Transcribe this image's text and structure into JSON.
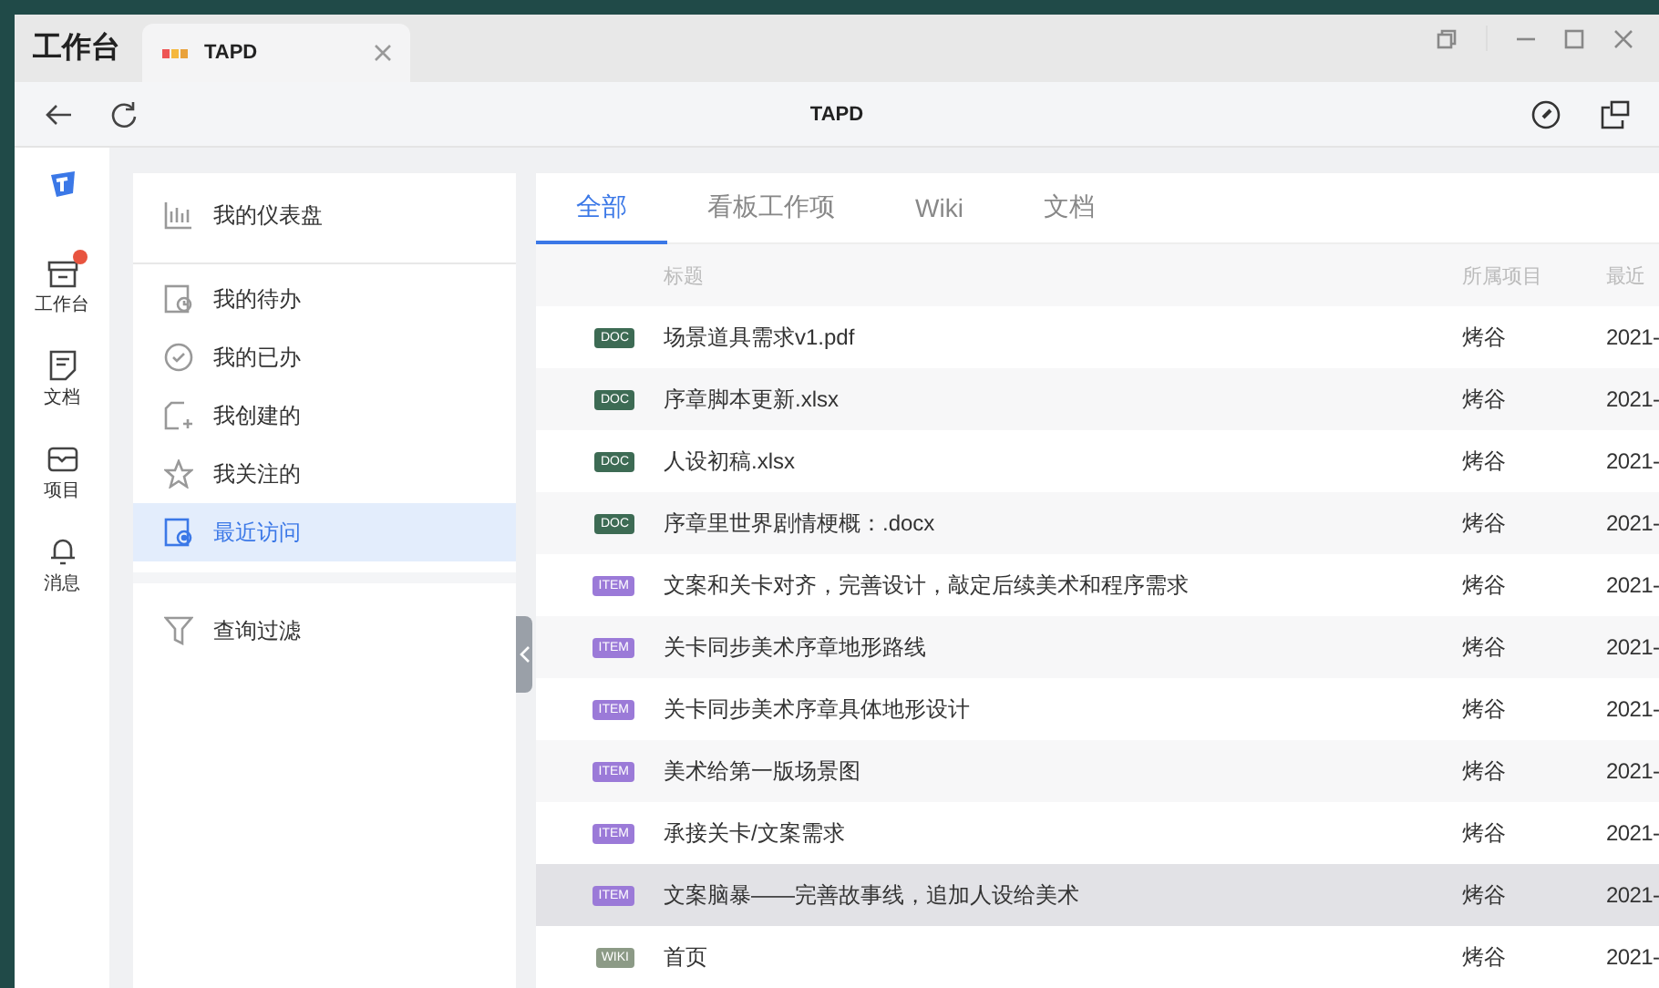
{
  "window": {
    "app_title": "工作台",
    "tab": {
      "title": "TAPD"
    },
    "page_title": "TAPD"
  },
  "rail": [
    {
      "label": "工作台",
      "kind": "workbench",
      "badge": true
    },
    {
      "label": "文档",
      "kind": "doc",
      "badge": false
    },
    {
      "label": "项目",
      "kind": "project",
      "badge": false
    },
    {
      "label": "消息",
      "kind": "bell",
      "badge": false
    }
  ],
  "menu": [
    {
      "label": "我的仪表盘",
      "kind": "chart",
      "selected": false
    },
    {
      "label": "我的待办",
      "kind": "todo",
      "selected": false
    },
    {
      "label": "我的已办",
      "kind": "done",
      "selected": false
    },
    {
      "label": "我创建的",
      "kind": "created",
      "selected": false
    },
    {
      "label": "我关注的",
      "kind": "star",
      "selected": false
    },
    {
      "label": "最近访问",
      "kind": "recent",
      "selected": true
    },
    {
      "label": "查询过滤",
      "kind": "filter",
      "selected": false
    }
  ],
  "tabs": [
    {
      "label": "全部",
      "selected": true
    },
    {
      "label": "看板工作项",
      "selected": false
    },
    {
      "label": "Wiki",
      "selected": false
    },
    {
      "label": "文档",
      "selected": false
    }
  ],
  "table": {
    "columns": [
      "标题",
      "所属项目",
      "最近"
    ],
    "rows": [
      {
        "type": "DOC",
        "title": "场景道具需求v1.pdf",
        "project": "烤谷",
        "date": "2021-",
        "hovered": false
      },
      {
        "type": "DOC",
        "title": "序章脚本更新.xlsx",
        "project": "烤谷",
        "date": "2021-",
        "hovered": false
      },
      {
        "type": "DOC",
        "title": "人设初稿.xlsx",
        "project": "烤谷",
        "date": "2021-",
        "hovered": false
      },
      {
        "type": "DOC",
        "title": "序章里世界剧情梗概：.docx",
        "project": "烤谷",
        "date": "2021-",
        "hovered": false
      },
      {
        "type": "ITEM",
        "title": "文案和关卡对齐，完善设计，敲定后续美术和程序需求",
        "project": "烤谷",
        "date": "2021-",
        "hovered": false
      },
      {
        "type": "ITEM",
        "title": "关卡同步美术序章地形路线",
        "project": "烤谷",
        "date": "2021-",
        "hovered": false
      },
      {
        "type": "ITEM",
        "title": "关卡同步美术序章具体地形设计",
        "project": "烤谷",
        "date": "2021-",
        "hovered": false
      },
      {
        "type": "ITEM",
        "title": "美术给第一版场景图",
        "project": "烤谷",
        "date": "2021-",
        "hovered": false
      },
      {
        "type": "ITEM",
        "title": "承接关卡/文案需求",
        "project": "烤谷",
        "date": "2021-",
        "hovered": false
      },
      {
        "type": "ITEM",
        "title": "文案脑暴——完善故事线，追加人设给美术",
        "project": "烤谷",
        "date": "2021-",
        "hovered": true
      },
      {
        "type": "WIKI",
        "title": "首页",
        "project": "烤谷",
        "date": "2021-",
        "hovered": false
      }
    ]
  }
}
